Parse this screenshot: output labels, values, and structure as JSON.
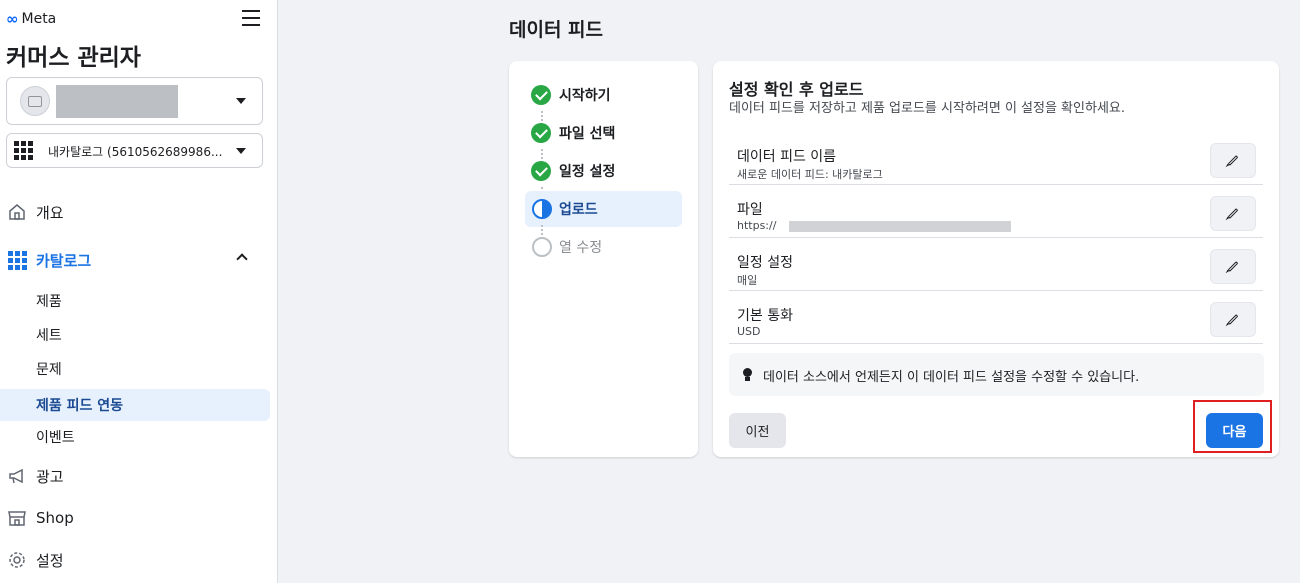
{
  "brand": "Meta",
  "app_title": "커머스 관리자",
  "catalog_selector": {
    "label": "내카탈로그 (5610562689986..."
  },
  "nav": {
    "overview": "개요",
    "catalog": "카탈로그",
    "catalog_sub": [
      "제품",
      "세트",
      "문제",
      "제품 피드 연동",
      "이벤트"
    ],
    "ads": "광고",
    "shop": "Shop",
    "settings": "설정"
  },
  "page_title": "데이터 피드",
  "steps": [
    {
      "label": "시작하기",
      "status": "done"
    },
    {
      "label": "파일 선택",
      "status": "done"
    },
    {
      "label": "일정 설정",
      "status": "done"
    },
    {
      "label": "업로드",
      "status": "current"
    },
    {
      "label": "열 수정",
      "status": "pending"
    }
  ],
  "review": {
    "title": "설정 확인 후 업로드",
    "description": "데이터 피드를 저장하고 제품 업로드를 시작하려면 이 설정을 확인하세요.",
    "rows": [
      {
        "label": "데이터 피드 이름",
        "value": "새로운 데이터 피드: 내카탈로그"
      },
      {
        "label": "파일",
        "value": "https://"
      },
      {
        "label": "일정 설정",
        "value": "매일"
      },
      {
        "label": "기본 통화",
        "value": "USD"
      }
    ],
    "tip": "데이터 소스에서 언제든지 이 데이터 피드 설정을 수정할 수 있습니다.",
    "prev_label": "이전",
    "next_label": "다음"
  },
  "colors": {
    "accent": "#1b74e4",
    "success": "#2aa745",
    "highlight": "#e02020"
  }
}
